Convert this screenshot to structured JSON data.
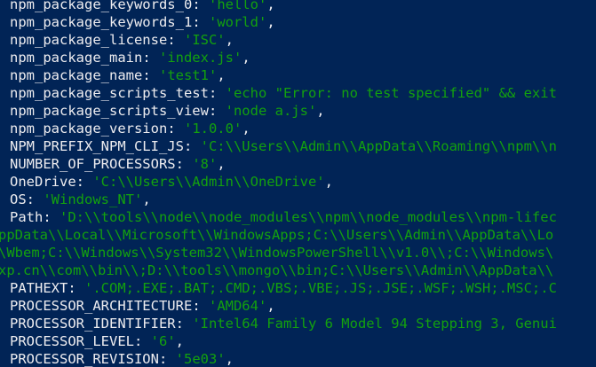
{
  "terminal": {
    "lines": [
      {
        "key": "npm_package_keywords_0",
        "sep": ": ",
        "value": "'hello'",
        "tail": ","
      },
      {
        "key": "npm_package_keywords_1",
        "sep": ": ",
        "value": "'world'",
        "tail": ","
      },
      {
        "key": "npm_package_license",
        "sep": ": ",
        "value": "'ISC'",
        "tail": ","
      },
      {
        "key": "npm_package_main",
        "sep": ": ",
        "value": "'index.js'",
        "tail": ","
      },
      {
        "key": "npm_package_name",
        "sep": ": ",
        "value": "'test1'",
        "tail": ","
      },
      {
        "key": "npm_package_scripts_test",
        "sep": ": ",
        "value": "'echo \"Error: no test specified\" && exit",
        "tail": ""
      },
      {
        "key": "npm_package_scripts_view",
        "sep": ": ",
        "value": "'node a.js'",
        "tail": ","
      },
      {
        "key": "npm_package_version",
        "sep": ": ",
        "value": "'1.0.0'",
        "tail": ","
      },
      {
        "key": "NPM_PREFIX_NPM_CLI_JS",
        "sep": ": ",
        "value": "'C:\\\\Users\\\\Admin\\\\AppData\\\\Roaming\\\\npm\\\\n",
        "tail": ""
      },
      {
        "key": "NUMBER_OF_PROCESSORS",
        "sep": ": ",
        "value": "'8'",
        "tail": ","
      },
      {
        "key": "OneDrive",
        "sep": ": ",
        "value": "'C:\\\\Users\\\\Admin\\\\OneDrive'",
        "tail": ","
      },
      {
        "key": "OS",
        "sep": ": ",
        "value": "'Windows_NT'",
        "tail": ","
      },
      {
        "key": "Path",
        "sep": ": ",
        "value": "'D:\\\\tools\\\\node\\\\node_modules\\\\npm\\\\node_modules\\\\npm-lifec",
        "tail": ""
      },
      {
        "key": "",
        "sep": "",
        "value": "ppData\\\\Local\\\\Microsoft\\\\WindowsApps;C:\\\\Users\\\\Admin\\\\AppData\\\\Lo",
        "tail": "",
        "wrap": true
      },
      {
        "key": "",
        "sep": "",
        "value": "\\Wbem;C:\\\\Windows\\\\System32\\\\WindowsPowerShell\\\\v1.0\\\\;C:\\\\Windows\\",
        "tail": "",
        "wrap": true
      },
      {
        "key": "",
        "sep": "",
        "value": "xp.cn\\\\com\\\\bin\\\\;D:\\\\tools\\\\mongo\\\\bin;C:\\\\Users\\\\Admin\\\\AppData\\\\",
        "tail": "",
        "wrap": true
      },
      {
        "key": "PATHEXT",
        "sep": ": ",
        "value": "'.COM;.EXE;.BAT;.CMD;.VBS;.VBE;.JS;.JSE;.WSF;.WSH;.MSC;.C",
        "tail": ""
      },
      {
        "key": "PROCESSOR_ARCHITECTURE",
        "sep": ": ",
        "value": "'AMD64'",
        "tail": ","
      },
      {
        "key": "PROCESSOR_IDENTIFIER",
        "sep": ": ",
        "value": "'Intel64 Family 6 Model 94 Stepping 3, Genui",
        "tail": ""
      },
      {
        "key": "PROCESSOR_LEVEL",
        "sep": ": ",
        "value": "'6'",
        "tail": ","
      },
      {
        "key": "PROCESSOR_REVISION",
        "sep": ": ",
        "value": "'5e03'",
        "tail": ","
      }
    ]
  },
  "colors": {
    "background": "#012456",
    "key_text": "#eeedf0",
    "value_text": "#13a10e"
  }
}
